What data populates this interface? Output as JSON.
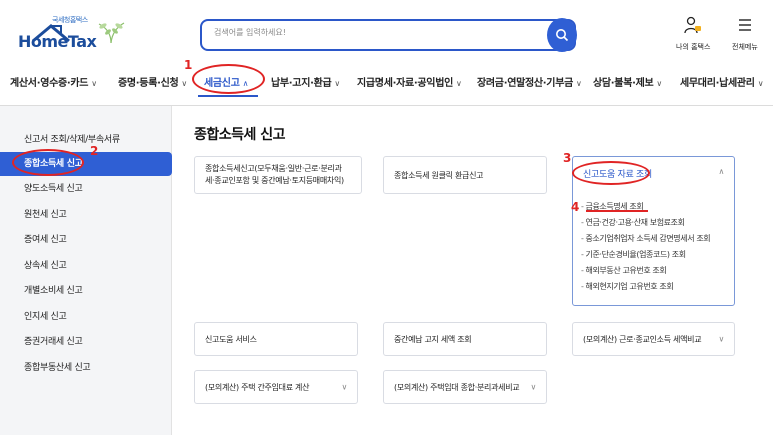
{
  "header": {
    "logo_sub": "국세청홈택스",
    "logo_main": "HomeTax",
    "search_placeholder": "검색어를 입력하세요!",
    "my_hometax": "나의 홈택스",
    "full_menu": "전체메뉴"
  },
  "gnb": [
    {
      "label": "계산서·영수증·카드"
    },
    {
      "label": "증명·등록·신청"
    },
    {
      "label": "세금신고"
    },
    {
      "label": "납부·고지·환급"
    },
    {
      "label": "지급명세·자료·공익법인"
    },
    {
      "label": "장려금·연말정산·기부금"
    },
    {
      "label": "상담·불복·제보"
    },
    {
      "label": "세무대리·납세관리"
    }
  ],
  "sidebar": [
    {
      "label": "신고서 조회/삭제/부속서류"
    },
    {
      "label": "종합소득세 신고"
    },
    {
      "label": "양도소득세 신고"
    },
    {
      "label": "원천세 신고"
    },
    {
      "label": "증여세 신고"
    },
    {
      "label": "상속세 신고"
    },
    {
      "label": "개별소비세 신고"
    },
    {
      "label": "인지세 신고"
    },
    {
      "label": "증권거래세 신고"
    },
    {
      "label": "종합부동산세 신고"
    }
  ],
  "main": {
    "title": "종합소득세 신고",
    "cards": {
      "general_line1": "종합소득세신고(모두채움·일반·근로·분리과",
      "general_line2": "세·종교인포함 및 중간예납·토지등매매차익)",
      "oneclick": "종합소득세 원클릭 환급신고",
      "help_data": "신고도움 자료 조회",
      "help_service": "신고도움 서비스",
      "interim_notice": "중간예납 고지 세액 조회",
      "mock_labor": "(모의계산) 근로·종교인소득 세액비교",
      "mock_rent": "(모의계산) 주택 간주임대료 계산",
      "mock_housing": "(모의계산) 주택임대 종합·분리과세비교"
    },
    "sub_items": [
      "금융소득명세 조회",
      "연금·건강·고용·산재 보험료조회",
      "중소기업취업자 소득세 감면명세서 조회",
      "기준·단순경비율(업종코드) 조회",
      "해외부동산 고유번호 조회",
      "해외현지기업 고유번호 조회"
    ]
  },
  "annotations": {
    "n1": "1",
    "n2": "2",
    "n3": "3",
    "n4": "4"
  }
}
